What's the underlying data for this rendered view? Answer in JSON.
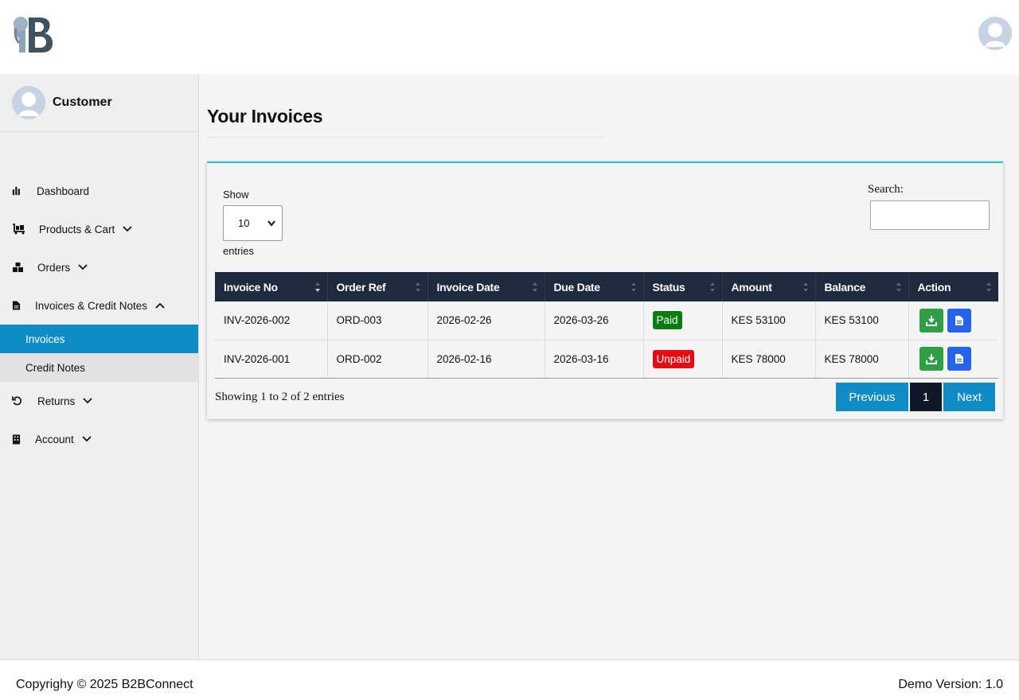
{
  "header": {
    "logo_icon": "elephant-b-logo",
    "avatar_icon": "user-avatar-icon"
  },
  "sidebar": {
    "user_name": "Customer",
    "items": [
      {
        "label": "Dashboard",
        "icon": "chart-bar-icon"
      },
      {
        "label": "Products & Cart",
        "icon": "cart-flatbed-icon"
      },
      {
        "label": "Orders",
        "icon": "boxes-icon"
      },
      {
        "label": "Invoices & Credit Notes",
        "icon": "file-icon"
      },
      {
        "label": "Returns",
        "icon": "undo-icon"
      },
      {
        "label": "Account",
        "icon": "building-icon"
      }
    ],
    "sub_items": [
      {
        "label": "Invoices",
        "active": true
      },
      {
        "label": "Credit Notes",
        "active": false
      }
    ],
    "active_color": "#0f8bc6"
  },
  "main": {
    "title": "Your Invoices",
    "show_label": "Show",
    "page_size": "10",
    "entries_label": "entries",
    "search_label": "Search:",
    "search_value": "",
    "columns": [
      "Invoice No",
      "Order Ref",
      "Invoice Date",
      "Due Date",
      "Status",
      "Amount",
      "Balance",
      "Action"
    ],
    "rows": [
      {
        "invoice_no": "INV-2026-002",
        "order_ref": "ORD-003",
        "invoice_date": "2026-02-26",
        "due_date": "2026-03-26",
        "status": "Paid",
        "amount": "KES 53100",
        "balance": "KES 53100"
      },
      {
        "invoice_no": "INV-2026-001",
        "order_ref": "ORD-002",
        "invoice_date": "2026-02-16",
        "due_date": "2026-03-16",
        "status": "Unpaid",
        "amount": "KES 78000",
        "balance": "KES 78000"
      }
    ],
    "showing_text": "Showing 1 to 2 of 2 entries",
    "pagination": {
      "previous": "Previous",
      "current": "1",
      "next": "Next"
    },
    "status_colors": {
      "Paid": "#0a7d12",
      "Unpaid": "#e50b13"
    },
    "accent_color": "#22c6e5"
  },
  "footer": {
    "copyright": "Copyrighy © 2025 B2BConnect",
    "version": "Demo Version: 1.0"
  }
}
